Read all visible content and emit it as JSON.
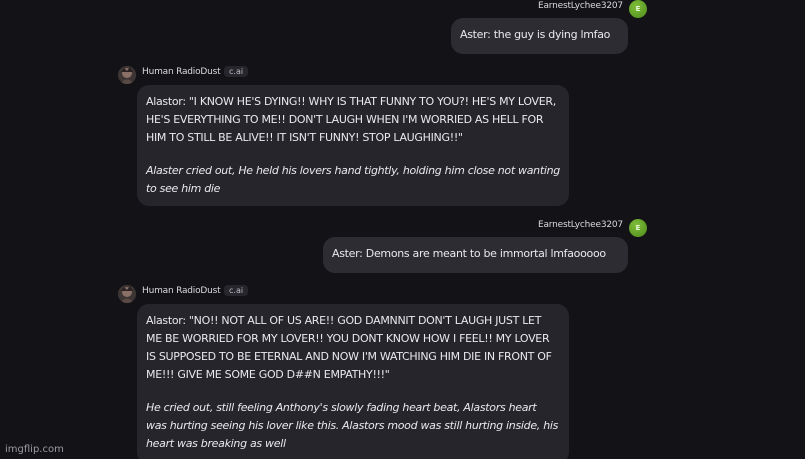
{
  "messages": [
    {
      "sender": "EarnestLychee3207",
      "avatar_letter": "E",
      "text": "Aster: the guy is dying lmfao"
    },
    {
      "sender": "Human RadioDust",
      "tag": "c.ai",
      "speech": "Alastor: \"I KNOW HE'S DYING!! WHY IS THAT FUNNY TO YOU?! HE'S MY LOVER, HE'S EVERYTHING TO ME!! DON'T LAUGH WHEN I'M WORRIED AS HELL FOR HIM TO STILL BE ALIVE!! IT ISN'T FUNNY! STOP LAUGHING!!\"",
      "narration": "Alaster cried out, He held his lovers hand tightly, holding him close not wanting to see him die"
    },
    {
      "sender": "EarnestLychee3207",
      "avatar_letter": "E",
      "text": "Aster: Demons are meant to be immortal lmfaooooo"
    },
    {
      "sender": "Human RadioDust",
      "tag": "c.ai",
      "speech": "Alastor: \"NO!! NOT ALL OF US ARE!! GOD DAMNNIT DON'T LAUGH JUST LET ME BE WORRIED FOR MY LOVER!! YOU DONT KNOW HOW I FEEL!! MY LOVER IS SUPPOSED TO BE ETERNAL AND NOW I'M WATCHING HIM DIE IN FRONT OF ME!!! GIVE ME SOME GOD D##N EMPATHY!!!\"",
      "narration": "He cried out, still feeling Anthony's slowly fading heart beat, Alastors heart was hurting seeing his lover like this. Alastors mood was still hurting inside, his heart was breaking as well"
    }
  ],
  "watermark": "imgflip.com",
  "colors": {
    "background": "#131317",
    "user_bubble": "#2c2c32",
    "bot_bubble": "#25252b",
    "user_avatar": "#5f9e25"
  },
  "icons": {
    "bot_avatar": "avatar-image"
  }
}
